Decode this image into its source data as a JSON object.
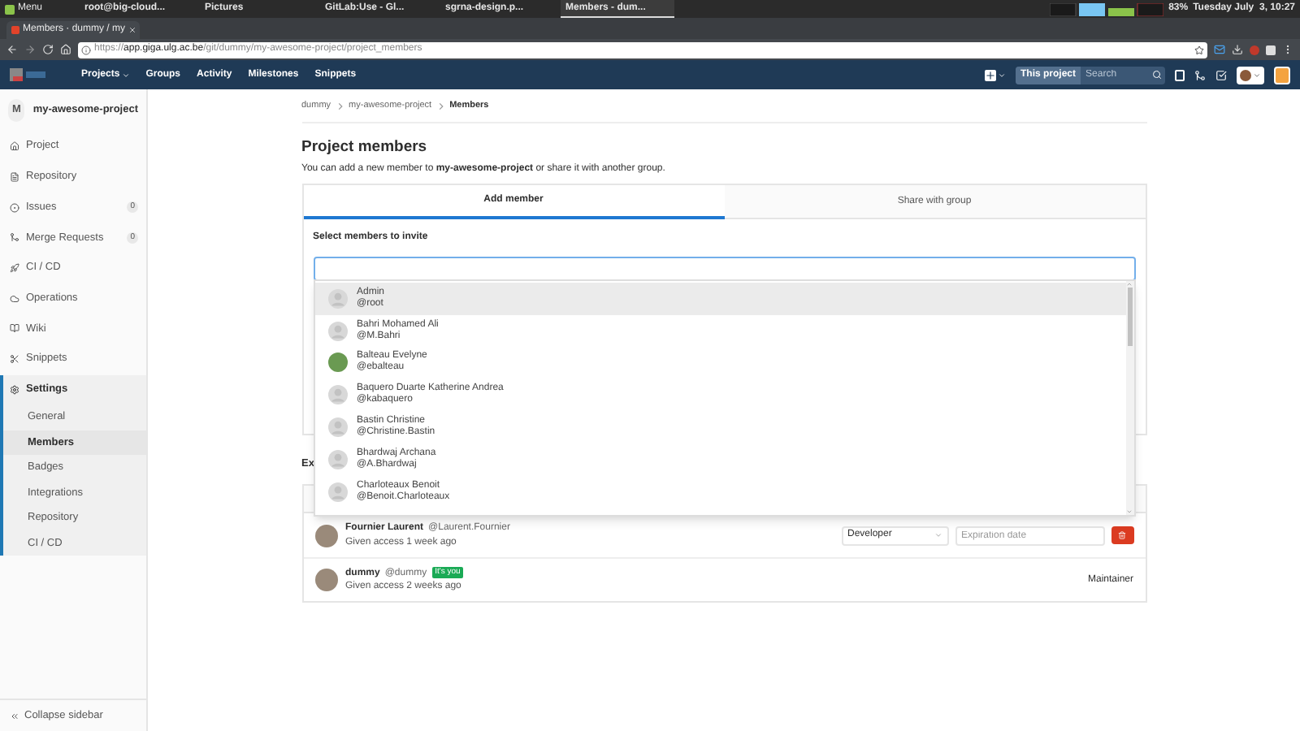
{
  "os_bar": {
    "menu_label": "Menu",
    "tasks": [
      {
        "label": "root@big-cloud...",
        "selected": false
      },
      {
        "label": "Pictures",
        "selected": false
      },
      {
        "label": "GitLab:Use - Gl...",
        "selected": false
      },
      {
        "label": "sgrna-design.p...",
        "selected": false
      },
      {
        "label": "Members - dum...",
        "selected": true
      }
    ],
    "battery": "83%",
    "clock": "Tuesday July  3, 10:27"
  },
  "browser": {
    "tab_title": "Members · dummy / my",
    "url_scheme": "https://",
    "url_host": "app.giga.ulg.ac.be",
    "url_path": "/git/dummy/my-awesome-project/project_members"
  },
  "navbar": {
    "links": [
      {
        "label": "Projects",
        "dropdown": true
      },
      {
        "label": "Groups",
        "dropdown": false
      },
      {
        "label": "Activity",
        "dropdown": false
      },
      {
        "label": "Milestones",
        "dropdown": false
      },
      {
        "label": "Snippets",
        "dropdown": false
      }
    ],
    "search_scope": "This project",
    "search_placeholder": "Search"
  },
  "sidebar": {
    "project_letter": "M",
    "project_name": "my-awesome-project",
    "items": [
      {
        "label": "Project",
        "selected": false
      },
      {
        "label": "Repository",
        "selected": false
      },
      {
        "label": "Issues",
        "badge": "0",
        "selected": false
      },
      {
        "label": "Merge Requests",
        "badge": "0",
        "selected": false
      },
      {
        "label": "CI / CD",
        "selected": false
      },
      {
        "label": "Operations",
        "selected": false
      },
      {
        "label": "Wiki",
        "selected": false
      },
      {
        "label": "Snippets",
        "selected": false
      },
      {
        "label": "Settings",
        "selected": true,
        "children": [
          {
            "label": "General",
            "selected": false
          },
          {
            "label": "Members",
            "selected": true
          },
          {
            "label": "Badges",
            "selected": false
          },
          {
            "label": "Integrations",
            "selected": false
          },
          {
            "label": "Repository",
            "selected": false
          },
          {
            "label": "CI / CD",
            "selected": false
          }
        ]
      }
    ],
    "collapse_label": "Collapse sidebar"
  },
  "main": {
    "breadcrumb": [
      "dummy",
      "my-awesome-project",
      "Members"
    ],
    "title": "Project members",
    "intro": "You can add a new member to **my-awesome-project** or share it with another group.",
    "tabs": [
      {
        "label": "Add member",
        "selected": true
      },
      {
        "label": "Share with group",
        "selected": false
      }
    ],
    "field_label": "Select members to invite",
    "dropdown": [
      {
        "name": "Admin",
        "username": "@root",
        "kind": "default",
        "selected": true
      },
      {
        "name": "Bahri Mohamed Ali",
        "username": "@M.Bahri",
        "kind": "default",
        "selected": false
      },
      {
        "name": "Balteau Evelyne",
        "username": "@ebalteau",
        "kind": "photo",
        "selected": false
      },
      {
        "name": "Baquero Duarte Katherine Andrea",
        "username": "@kabaquero",
        "kind": "default",
        "selected": false
      },
      {
        "name": "Bastin Christine",
        "username": "@Christine.Bastin",
        "kind": "default",
        "selected": false
      },
      {
        "name": "Bhardwaj Archana",
        "username": "@A.Bhardwaj",
        "kind": "default",
        "selected": false
      },
      {
        "name": "Charloteaux Benoit",
        "username": "@Benoit.Charloteaux",
        "kind": "default",
        "selected": false
      }
    ],
    "members_heading": "Ex",
    "members": [
      {
        "kind": "editable",
        "name": "Fournier Laurent",
        "username": "@Laurent.Fournier",
        "access": "Given access 1 week ago",
        "role": "Developer",
        "expiration_placeholder": "Expiration date"
      },
      {
        "kind": "static",
        "name": "dummy",
        "username": "@dummy",
        "badge": "It's you",
        "access": "Given access 2 weeks ago",
        "role": "Maintainer"
      }
    ]
  }
}
